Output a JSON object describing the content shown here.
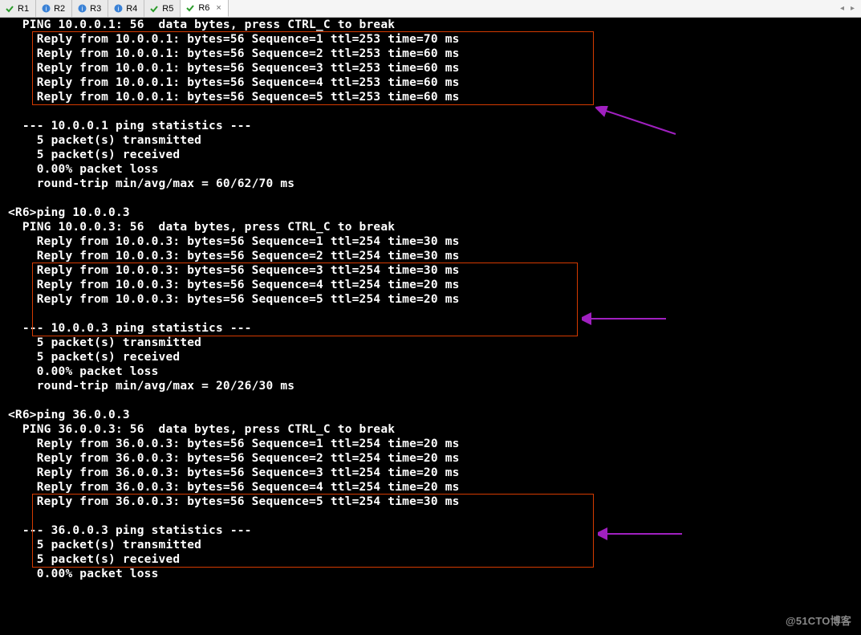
{
  "tabs": [
    {
      "label": "R1",
      "icon": "check"
    },
    {
      "label": "R2",
      "icon": "info"
    },
    {
      "label": "R3",
      "icon": "info"
    },
    {
      "label": "R4",
      "icon": "info"
    },
    {
      "label": "R5",
      "icon": "check"
    },
    {
      "label": "R6",
      "icon": "check",
      "active": true,
      "closeable": true
    }
  ],
  "nav": {
    "left": "◂",
    "right": "▸"
  },
  "terminal": {
    "blocks": [
      {
        "header": "  PING 10.0.0.1: 56  data bytes, press CTRL_C to break",
        "replies": [
          "    Reply from 10.0.0.1: bytes=56 Sequence=1 ttl=253 time=70 ms",
          "    Reply from 10.0.0.1: bytes=56 Sequence=2 ttl=253 time=60 ms",
          "    Reply from 10.0.0.1: bytes=56 Sequence=3 ttl=253 time=60 ms",
          "    Reply from 10.0.0.1: bytes=56 Sequence=4 ttl=253 time=60 ms",
          "    Reply from 10.0.0.1: bytes=56 Sequence=5 ttl=253 time=60 ms"
        ],
        "stats": [
          "",
          "  --- 10.0.0.1 ping statistics ---",
          "    5 packet(s) transmitted",
          "    5 packet(s) received",
          "    0.00% packet loss",
          "    round-trip min/avg/max = 60/62/70 ms",
          ""
        ]
      },
      {
        "prompt": "<R6>ping 10.0.0.3",
        "header": "  PING 10.0.0.3: 56  data bytes, press CTRL_C to break",
        "replies": [
          "    Reply from 10.0.0.3: bytes=56 Sequence=1 ttl=254 time=30 ms",
          "    Reply from 10.0.0.3: bytes=56 Sequence=2 ttl=254 time=30 ms",
          "    Reply from 10.0.0.3: bytes=56 Sequence=3 ttl=254 time=30 ms",
          "    Reply from 10.0.0.3: bytes=56 Sequence=4 ttl=254 time=20 ms",
          "    Reply from 10.0.0.3: bytes=56 Sequence=5 ttl=254 time=20 ms"
        ],
        "stats": [
          "",
          "  --- 10.0.0.3 ping statistics ---",
          "    5 packet(s) transmitted",
          "    5 packet(s) received",
          "    0.00% packet loss",
          "    round-trip min/avg/max = 20/26/30 ms",
          ""
        ]
      },
      {
        "prompt": "<R6>ping 36.0.0.3",
        "header": "  PING 36.0.0.3: 56  data bytes, press CTRL_C to break",
        "replies": [
          "    Reply from 36.0.0.3: bytes=56 Sequence=1 ttl=254 time=20 ms",
          "    Reply from 36.0.0.3: bytes=56 Sequence=2 ttl=254 time=20 ms",
          "    Reply from 36.0.0.3: bytes=56 Sequence=3 ttl=254 time=20 ms",
          "    Reply from 36.0.0.3: bytes=56 Sequence=4 ttl=254 time=20 ms",
          "    Reply from 36.0.0.3: bytes=56 Sequence=5 ttl=254 time=30 ms"
        ],
        "stats": [
          "",
          "  --- 36.0.0.3 ping statistics ---",
          "    5 packet(s) transmitted",
          "    5 packet(s) received",
          "    0.00% packet loss"
        ]
      }
    ]
  },
  "watermark": "@51CTO博客"
}
